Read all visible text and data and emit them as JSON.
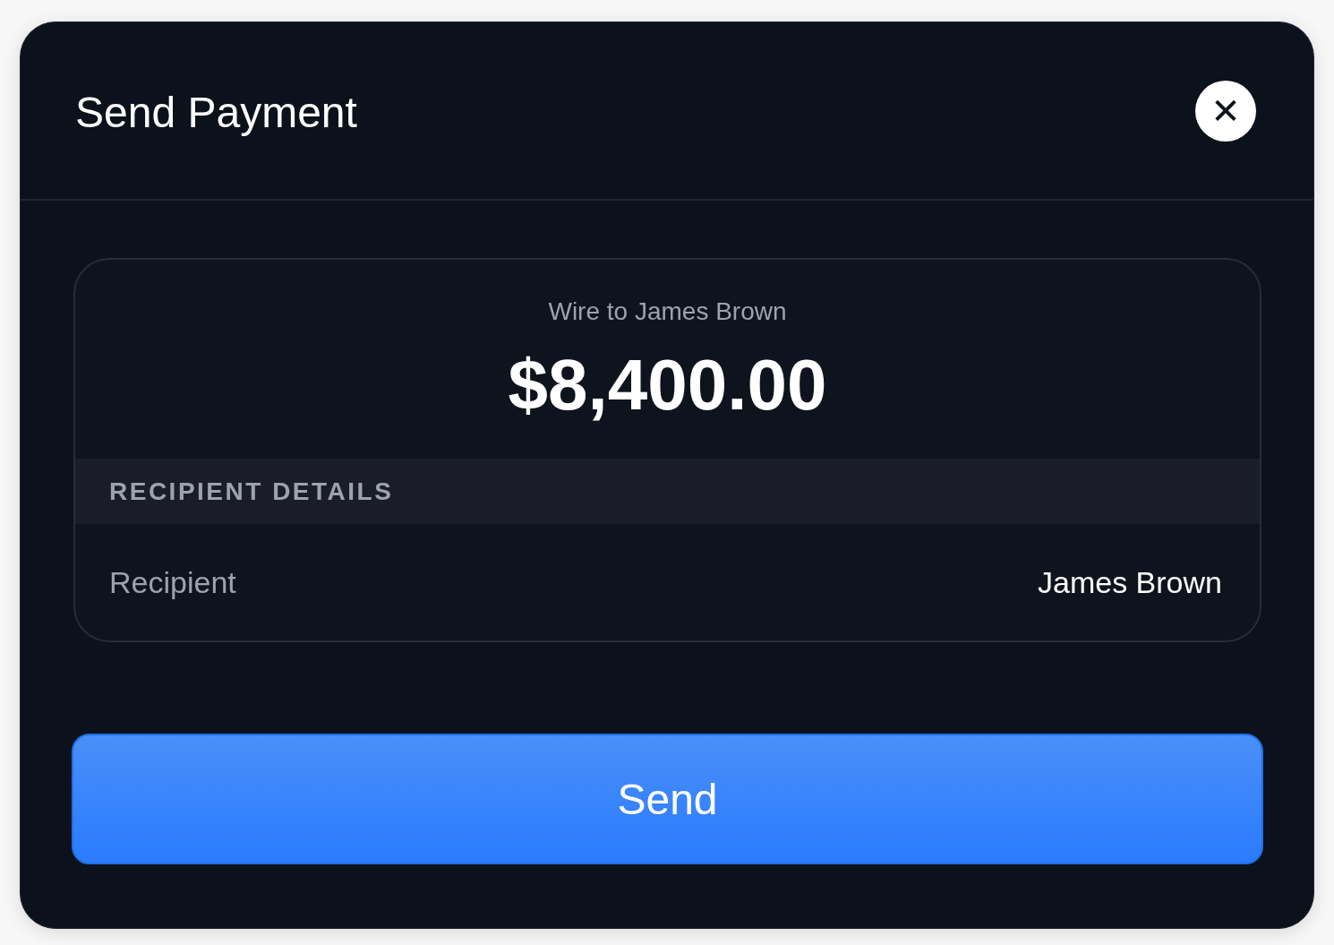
{
  "dialog": {
    "title": "Send Payment",
    "close_label": "✕"
  },
  "summary": {
    "subtitle": "Wire to James Brown",
    "amount": "$8,400.00"
  },
  "section": {
    "heading": "RECIPIENT DETAILS",
    "rows": [
      {
        "label": "Recipient",
        "value": "James Brown"
      }
    ]
  },
  "primary_button": {
    "label": "Send"
  }
}
